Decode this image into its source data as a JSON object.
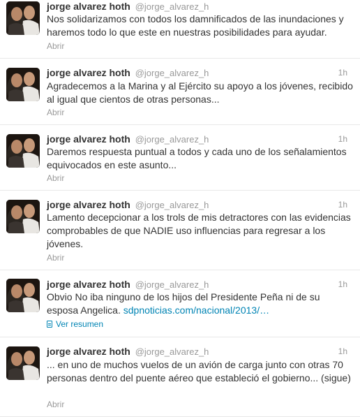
{
  "tweets": [
    {
      "name": "jorge alvarez hoth",
      "username": "@jorge_alvarez_h",
      "time": "",
      "text": "Nos solidarizamos con todos los damnificados de las inundaciones y haremos todo lo que este en nuestras posibilidades para ayudar.",
      "action": "Abrir"
    },
    {
      "name": "jorge alvarez hoth",
      "username": "@jorge_alvarez_h",
      "time": "1h",
      "text": "Agradecemos a la Marina y al Ejército su apoyo a los jóvenes, recibido al igual que cientos de otras personas...",
      "action": "Abrir"
    },
    {
      "name": "jorge alvarez hoth",
      "username": "@jorge_alvarez_h",
      "time": "1h",
      "text": "Daremos  respuesta puntual a todos y cada uno de los señalamientos equivocados en este asunto...",
      "action": "Abrir"
    },
    {
      "name": "jorge alvarez hoth",
      "username": "@jorge_alvarez_h",
      "time": "1h",
      "text": "Lamento decepcionar a los trols de mis detractores con las evidencias comprobables de que NADIE uso influencias para regresar a los jóvenes.",
      "action": "Abrir"
    },
    {
      "name": "jorge alvarez hoth",
      "username": "@jorge_alvarez_h",
      "time": "1h",
      "text": "Obvio No iba ninguno de los hijos del Presidente Peña ni de su esposa Angelica.",
      "link": "sdpnoticias.com/nacional/2013/…",
      "action": "Ver resumen"
    },
    {
      "name": "jorge alvarez hoth",
      "username": "@jorge_alvarez_h",
      "time": "1h",
      "text": "... en uno de muchos vuelos de un avión de carga junto con otras 70 personas dentro del puente aéreo que estableció el gobierno... (sigue)",
      "action": "Abrir"
    }
  ]
}
